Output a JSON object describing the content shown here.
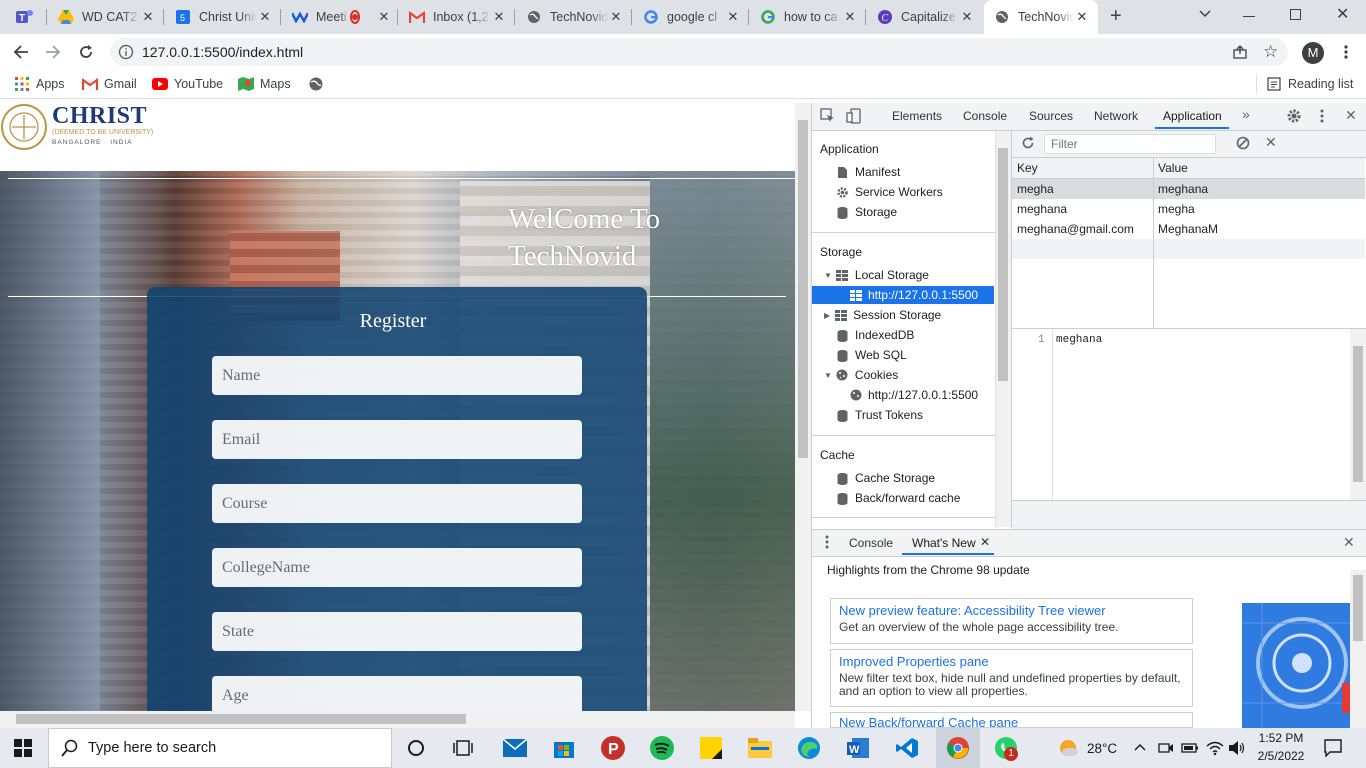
{
  "browser": {
    "tabs": [
      {
        "title": "WD CAT2",
        "icon": "google-drive-icon"
      },
      {
        "title": "Christ Univ",
        "icon": "google-sites-icon"
      },
      {
        "title": "Meeti",
        "icon": "webex-icon"
      },
      {
        "title": "Inbox (1,2",
        "icon": "gmail-icon"
      },
      {
        "title": "TechNovid",
        "icon": "globe-icon"
      },
      {
        "title": "google cl",
        "icon": "google-icon"
      },
      {
        "title": "how to ca",
        "icon": "google-icon"
      },
      {
        "title": "Capitalize",
        "icon": "capitalize-icon"
      },
      {
        "title": "TechNovid",
        "icon": "globe-icon",
        "active": true
      }
    ],
    "url": "127.0.0.1:5500/index.html",
    "profile_initial": "M",
    "bookmarks": [
      "Apps",
      "Gmail",
      "YouTube",
      "Maps"
    ],
    "reading_list": "Reading list"
  },
  "page": {
    "logo_text": "CHRIST",
    "logo_sub1": "(DEEMED TO BE UNIVERSITY)",
    "logo_sub2": "BANGALORE · INDIA",
    "welcome_line1": "WelCome To",
    "welcome_line2": "TechNovid",
    "form": {
      "title": "Register",
      "placeholders": [
        "Name",
        "Email",
        "Course",
        "CollegeName",
        "State",
        "Age"
      ]
    }
  },
  "devtools": {
    "tabs": [
      "Elements",
      "Console",
      "Sources",
      "Network",
      "Application"
    ],
    "active_tab": "Application",
    "sidebar": {
      "application_header": "Application",
      "application_items": [
        "Manifest",
        "Service Workers",
        "Storage"
      ],
      "storage_header": "Storage",
      "local_storage": "Local Storage",
      "local_origin": "http://127.0.0.1:5500",
      "session_storage": "Session Storage",
      "indexeddb": "IndexedDB",
      "websql": "Web SQL",
      "cookies": "Cookies",
      "cookie_origin": "http://127.0.0.1:5500",
      "trust_tokens": "Trust Tokens",
      "cache_header": "Cache",
      "cache_items": [
        "Cache Storage",
        "Back/forward cache"
      ]
    },
    "filter_placeholder": "Filter",
    "table": {
      "key_header": "Key",
      "value_header": "Value",
      "rows": [
        {
          "key": "megha",
          "value": "meghana"
        },
        {
          "key": "meghana",
          "value": "megha"
        },
        {
          "key": "meghana@gmail.com",
          "value": "MeghanaM"
        }
      ]
    },
    "preview": {
      "line_number": "1",
      "text": "meghana"
    },
    "drawer": {
      "tabs": [
        "Console",
        "What's New"
      ],
      "heading": "Highlights from the Chrome 98 update",
      "cards": [
        {
          "title": "New preview feature: Accessibility Tree viewer",
          "desc": "Get an overview of the whole page accessibility tree."
        },
        {
          "title": "Improved Properties pane",
          "desc": "New filter text box, hide null and undefined properties by default, and an option to view all properties."
        },
        {
          "title": "New Back/forward Cache pane",
          "desc": ""
        }
      ]
    }
  },
  "taskbar": {
    "search_placeholder": "Type here to search",
    "weather": "28°C",
    "time": "1:52 PM",
    "date": "2/5/2022",
    "whatsapp_badge": "1"
  }
}
